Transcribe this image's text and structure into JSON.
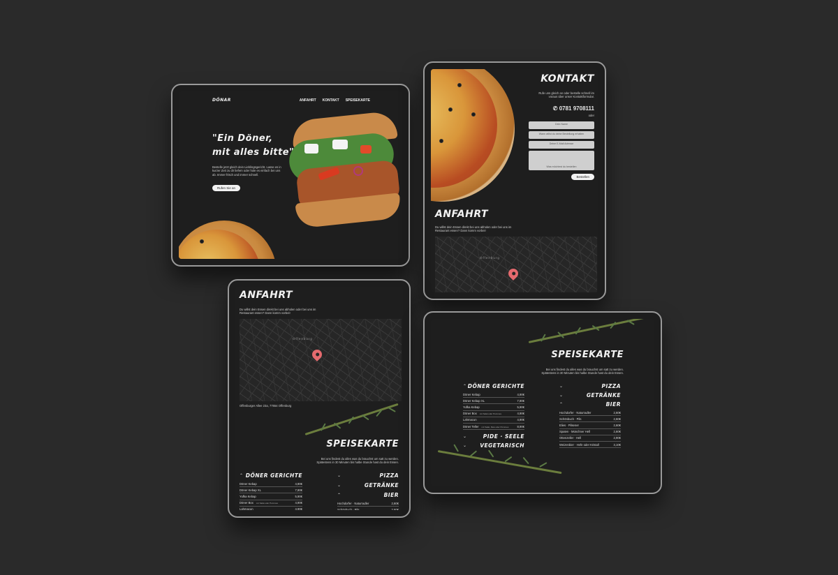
{
  "t1": {
    "logo": "DÖNAR",
    "nav": [
      "ANFAHRT",
      "KONTAKT",
      "SPEISEKARTE"
    ],
    "headline_1": "\"Ein Döner,",
    "headline_2": "mit alles bitte\"",
    "intro": "Bestelle jetzt gleich dein Lieblingsgericht. Lasse es in kurzer Zeit zu dir liefern oder hole es einfach bei uns ab. Immer frisch und immer schnell.",
    "cta": "Rufen Sie an"
  },
  "t2": {
    "kontakt_title": "Kontakt",
    "kontakt_text": "Rufe uns gleich an oder bestelle schnell im voraus über unser Kontaktformular.",
    "phone": "✆ 0781 9708111",
    "oder": "oder",
    "form": {
      "name": "Dein Name",
      "order": "Wann willst du deine Bestellung erhalten",
      "email": "Deine E-Mail Adresse",
      "message": "Was möchtest du bestellen",
      "submit": "Bestellen"
    },
    "anfahrt_title": "Anfahrt",
    "anfahrt_text": "Du willst dein Essen direkt bei uns abholen oder bei uns im Restaurant essen? Dann komm vorbei!",
    "map_label": "Offenburg"
  },
  "t3": {
    "anfahrt_title": "Anfahrt",
    "anfahrt_text": "Du willst dein Essen direkt bei uns abholen oder bei uns im Restaurant essen? Dann komm vorbei!",
    "map_label": "Offenburg",
    "address": "Offenburger Allee 23a, 77654 Offenburg",
    "speise_title": "Speisekarte",
    "speise_text": "Bei uns findest du alles was du brauchst um satt zu werden. Spätestens in 30 Minuten bis halbe Stunde hast du dein Essen.",
    "doener_head": "Döner Gerichte",
    "doener": [
      {
        "name": "Döner Kebap",
        "note": "",
        "price": "4,90€"
      },
      {
        "name": "Döner Kebap XL",
        "note": "",
        "price": "7,90€"
      },
      {
        "name": "Yufka Kebap",
        "note": "",
        "price": "5,90€"
      },
      {
        "name": "Döner Box",
        "note": "mit Salat oder Pommes",
        "price": "4,90€"
      },
      {
        "name": "Lahmacun",
        "note": "",
        "price": "4,90€"
      }
    ],
    "right_heads": [
      "Pizza",
      "Getränke",
      "Bier"
    ],
    "bier": [
      {
        "name": "Hochdorfer · Naturradler",
        "price": "2,60€"
      },
      {
        "name": "Schönbuch · Pils",
        "price": "2,60€"
      }
    ]
  },
  "t4": {
    "speise_title": "Speisekarte",
    "speise_text": "Bei uns findest du alles was du brauchst um satt zu werden. Spätestens in 30 Minuten bis halbe Stunde hast du dein Essen.",
    "doener_head": "Döner Gerichte",
    "doener": [
      {
        "name": "Döner Kebap",
        "note": "",
        "price": "4,90€"
      },
      {
        "name": "Döner Kebap XL",
        "note": "",
        "price": "7,90€"
      },
      {
        "name": "Yufka Kebap",
        "note": "",
        "price": "5,90€"
      },
      {
        "name": "Döner Box",
        "note": "mit Salat oder Pommes",
        "price": "4,90€"
      },
      {
        "name": "Lahmacun",
        "note": "",
        "price": "4,90€"
      },
      {
        "name": "Döner Teller",
        "note": "mit Salat, Reis oder Pommes",
        "price": "8,90€"
      }
    ],
    "left_more": [
      "Pide · Seele",
      "Vegetarisch"
    ],
    "right_heads": [
      "Pizza",
      "Getränke",
      "Bier"
    ],
    "bier": [
      {
        "name": "Hochdorfer · Naturradler",
        "price": "2,60€"
      },
      {
        "name": "Schönbuch · Pils",
        "price": "2,60€"
      },
      {
        "name": "Elies · Pilsener",
        "price": "2,60€"
      },
      {
        "name": "Spaten · Münchner Hell",
        "price": "2,60€"
      },
      {
        "name": "Ottenzeller · Hell",
        "price": "2,90€"
      },
      {
        "name": "Weizenbier · Hefe oder Kristall",
        "price": "3,10€"
      }
    ]
  }
}
